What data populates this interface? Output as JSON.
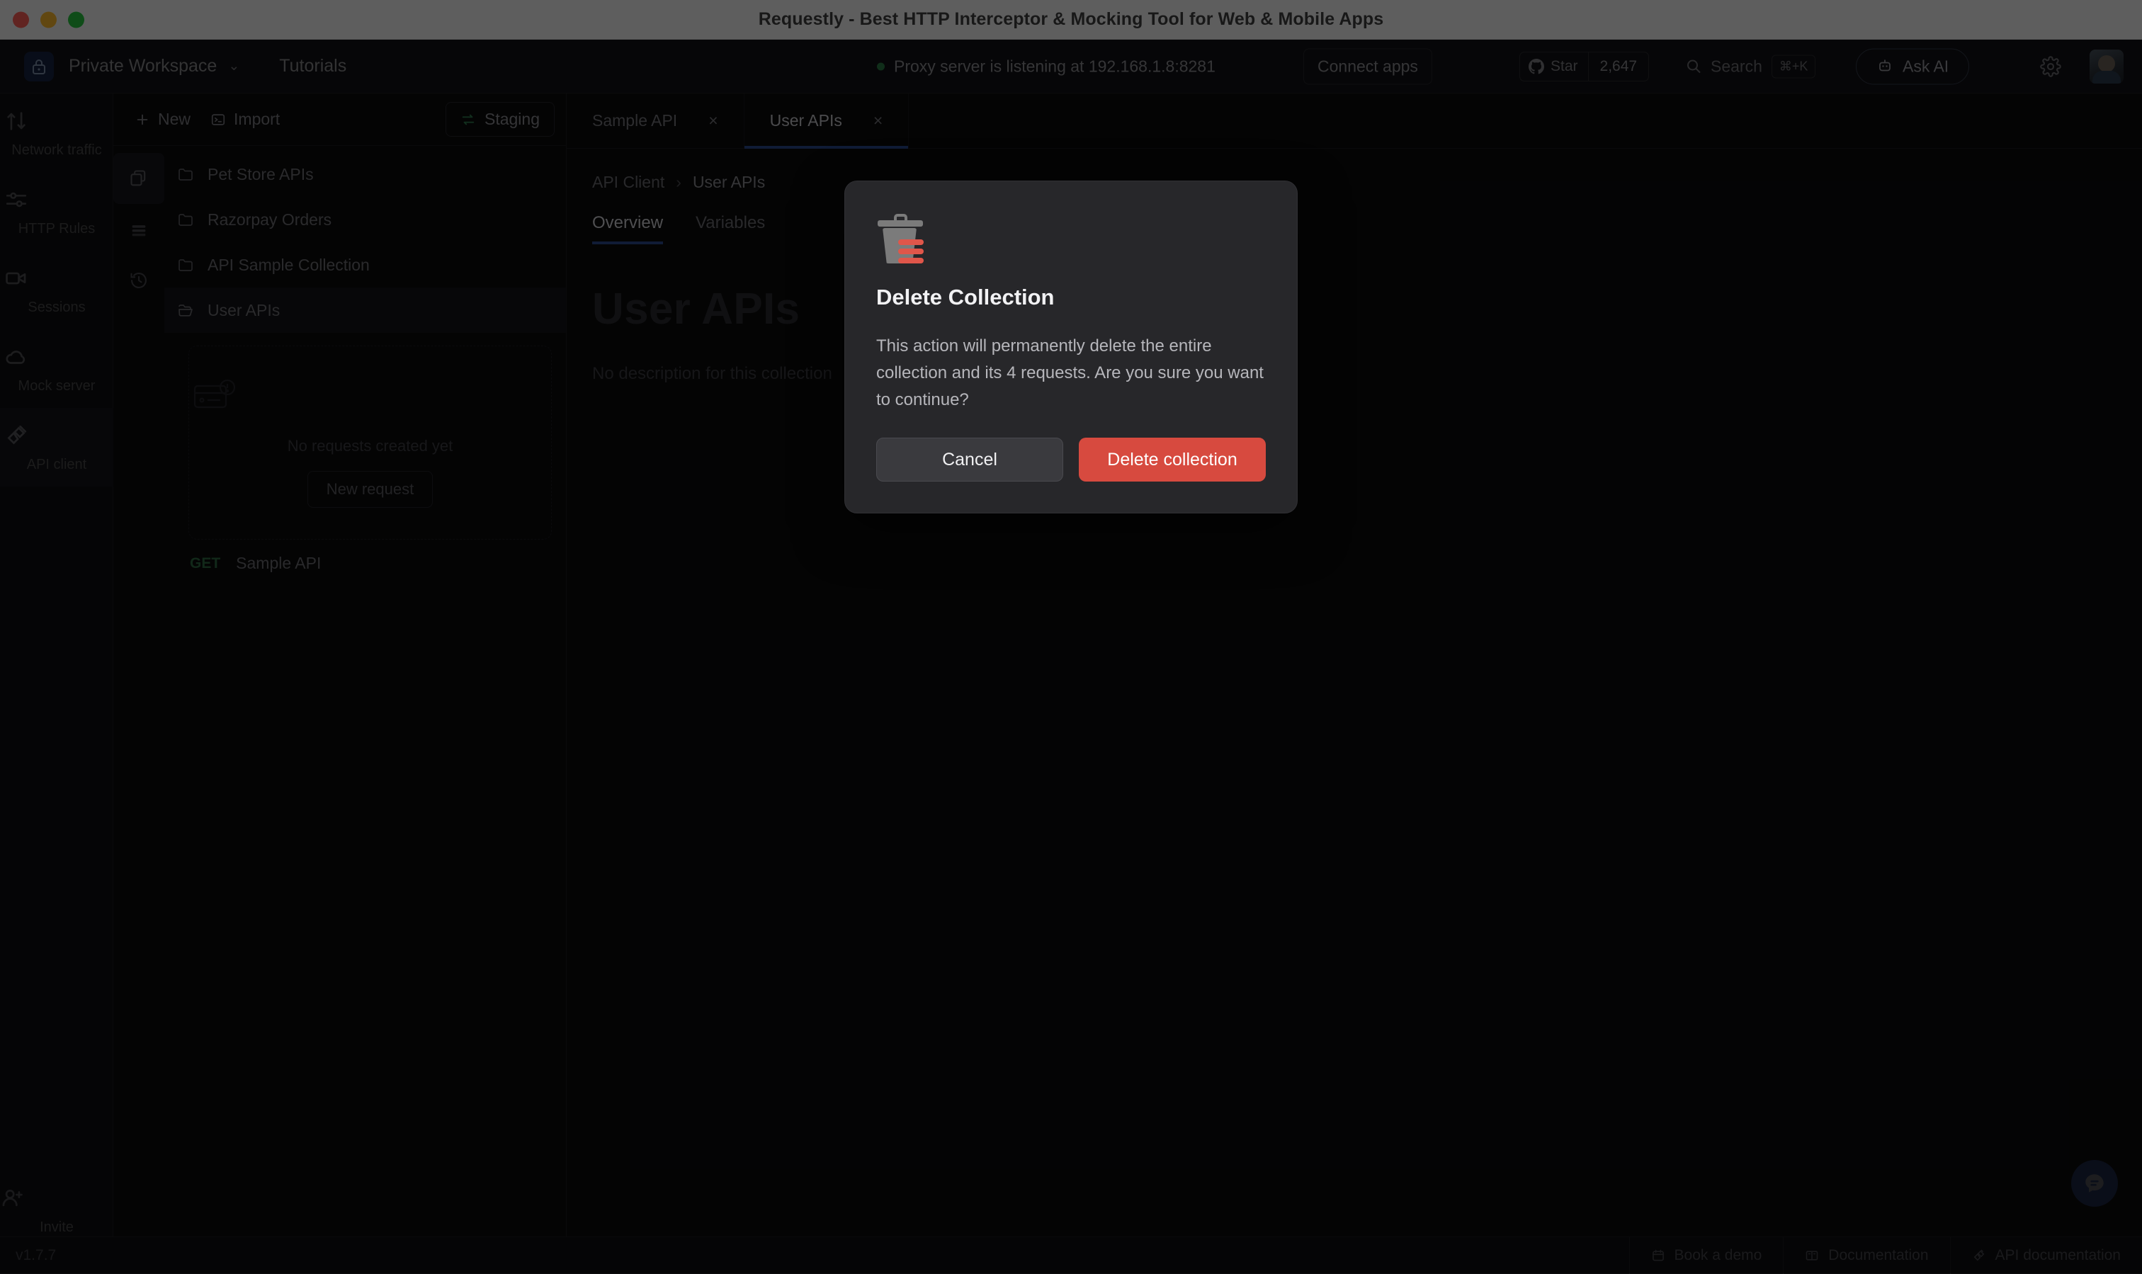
{
  "window": {
    "title": "Requestly - Best HTTP Interceptor & Mocking Tool for Web & Mobile Apps",
    "close_label": "close",
    "minimize_label": "minimize",
    "zoom_label": "zoom"
  },
  "header": {
    "workspace": "Private Workspace",
    "workspace_caret": "⌄",
    "tutorials": "Tutorials",
    "proxy_status": "Proxy server is listening at 192.168.1.8:8281",
    "proxy_status_color": "#2b7a45",
    "connect_apps": "Connect apps",
    "github_star_label": "Star",
    "github_star_count": "2,647",
    "search_placeholder": "Search",
    "search_shortcut": "⌘+K",
    "ask_ai": "Ask AI"
  },
  "rail": {
    "items": [
      {
        "label": "Network traffic",
        "icon": "network-traffic-icon",
        "active": false
      },
      {
        "label": "HTTP Rules",
        "icon": "sliders-icon",
        "active": false
      },
      {
        "label": "Sessions",
        "icon": "video-camera-icon",
        "active": false
      },
      {
        "label": "Mock server",
        "icon": "cloud-icon",
        "active": false
      },
      {
        "label": "API client",
        "icon": "plug-icon",
        "active": true
      }
    ],
    "invite": "Invite"
  },
  "panel": {
    "new_label": "New",
    "import_label": "Import",
    "environment_label": "Staging",
    "icons": [
      {
        "name": "collections-icon",
        "active": true
      },
      {
        "name": "environments-icon",
        "active": false
      },
      {
        "name": "history-icon",
        "active": false
      }
    ],
    "collections": [
      {
        "name": "Pet Store APIs",
        "selected": false,
        "open": false
      },
      {
        "name": "Razorpay Orders",
        "selected": false,
        "open": false
      },
      {
        "name": "API Sample Collection",
        "selected": false,
        "open": false
      },
      {
        "name": "User APIs",
        "selected": true,
        "open": true
      }
    ],
    "empty_state": {
      "text": "No requests created yet",
      "button": "New request"
    },
    "requests": [
      {
        "method": "GET",
        "name": "Sample API",
        "method_color": "#2f6b43"
      }
    ]
  },
  "main": {
    "tabs": [
      {
        "label": "Sample API",
        "active": false,
        "close": "×"
      },
      {
        "label": "User APIs",
        "active": true,
        "close": "×"
      }
    ],
    "breadcrumb": {
      "root": "API Client",
      "separator": "›",
      "current": "User APIs"
    },
    "subtabs": [
      {
        "label": "Overview",
        "active": true
      },
      {
        "label": "Variables",
        "active": false
      }
    ],
    "collection_title": "User APIs",
    "collection_description": "No description for this collection"
  },
  "statusbar": {
    "version": "v1.7.7",
    "links": [
      {
        "label": "Book a demo",
        "icon": "calendar-icon"
      },
      {
        "label": "Documentation",
        "icon": "book-icon"
      },
      {
        "label": "API documentation",
        "icon": "plug-icon"
      }
    ]
  },
  "fab": {
    "name": "chat-bubble-icon"
  },
  "dialog": {
    "icon": "trash-delete-icon",
    "title": "Delete Collection",
    "message": "This action will permanently delete the entire collection and its 4 requests. Are you sure you want to continue?",
    "cancel_label": "Cancel",
    "confirm_label": "Delete collection",
    "confirm_color": "#d74a3f"
  }
}
